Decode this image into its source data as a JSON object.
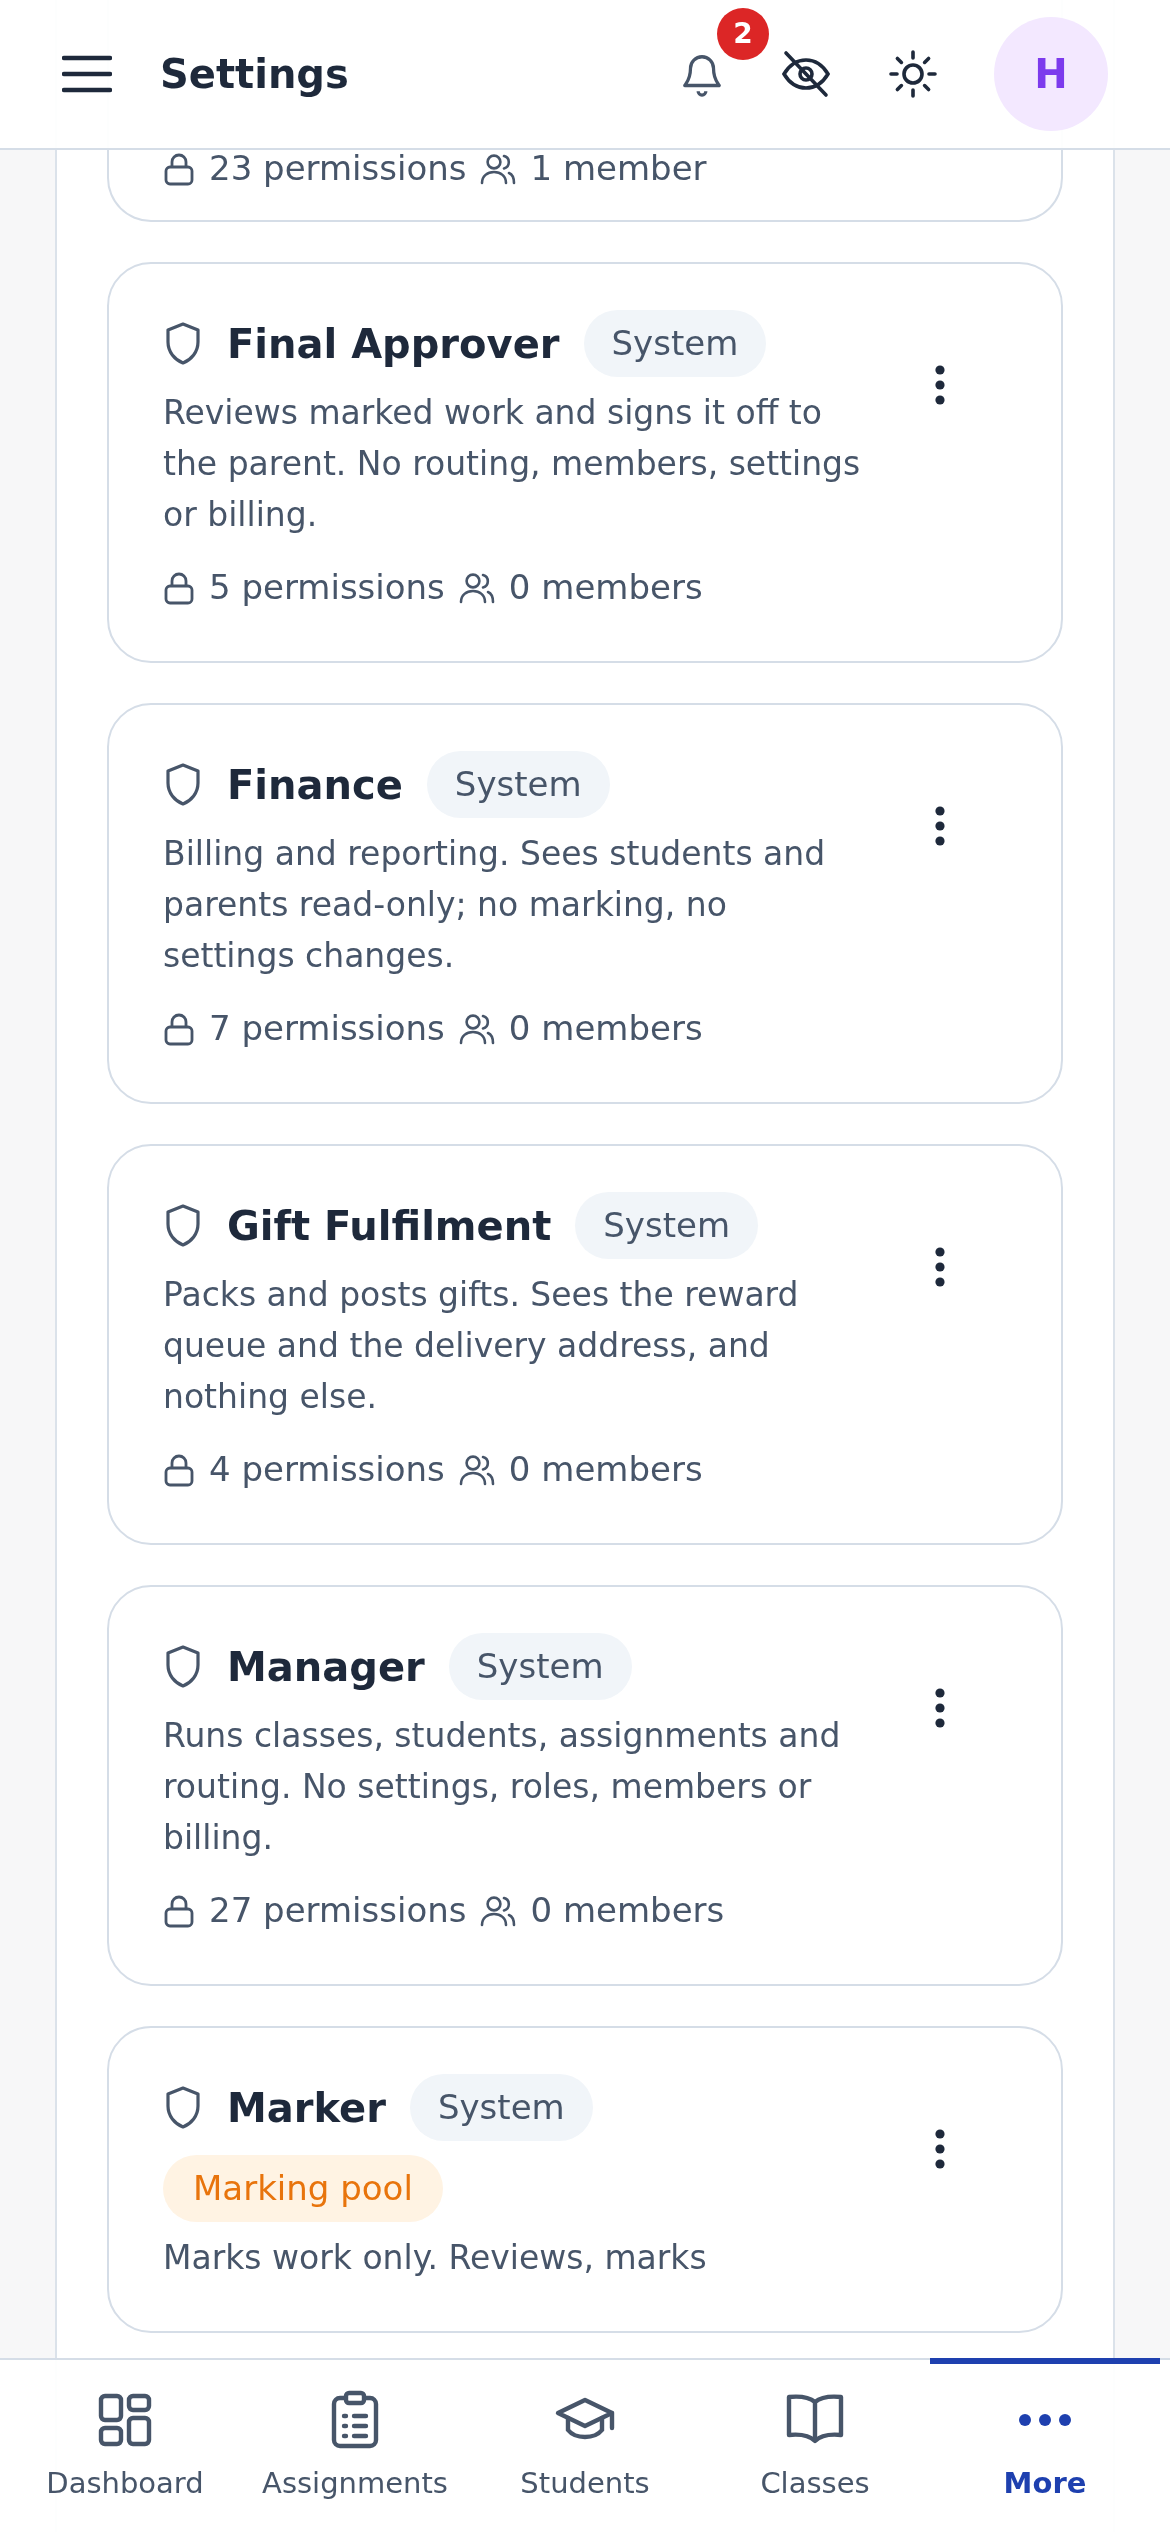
{
  "header": {
    "title": "Settings",
    "notification_count": "2",
    "avatar_initial": "H"
  },
  "partial_role": {
    "permissions": "23 permissions",
    "members": "1 member"
  },
  "roles": [
    {
      "name": "Final Approver",
      "badge": "System",
      "description": "Reviews marked work and signs it off to the parent. No routing, members, settings or billing.",
      "permissions": "5 permissions",
      "members": "0 members"
    },
    {
      "name": "Finance",
      "badge": "System",
      "description": "Billing and reporting. Sees students and parents read-only; no marking, no settings changes.",
      "permissions": "7 permissions",
      "members": "0 members"
    },
    {
      "name": "Gift Fulfilment",
      "badge": "System",
      "description": "Packs and posts gifts. Sees the reward queue and the delivery address, and nothing else.",
      "permissions": "4 permissions",
      "members": "0 members"
    },
    {
      "name": "Manager",
      "badge": "System",
      "description": "Runs classes, students, assignments and routing. No settings, roles, members or billing.",
      "permissions": "27 permissions",
      "members": "0 members"
    },
    {
      "name": "Marker",
      "badge": "System",
      "tag": "Marking pool",
      "description": "Marks work only. Reviews, marks"
    }
  ],
  "nav": [
    {
      "kind": "dashboard",
      "label": "Dashboard",
      "selected": false
    },
    {
      "kind": "assignments",
      "label": "Assignments",
      "selected": false
    },
    {
      "kind": "students",
      "label": "Students",
      "selected": false
    },
    {
      "kind": "classes",
      "label": "Classes",
      "selected": false
    },
    {
      "kind": "more",
      "label": "More",
      "selected": true
    }
  ]
}
